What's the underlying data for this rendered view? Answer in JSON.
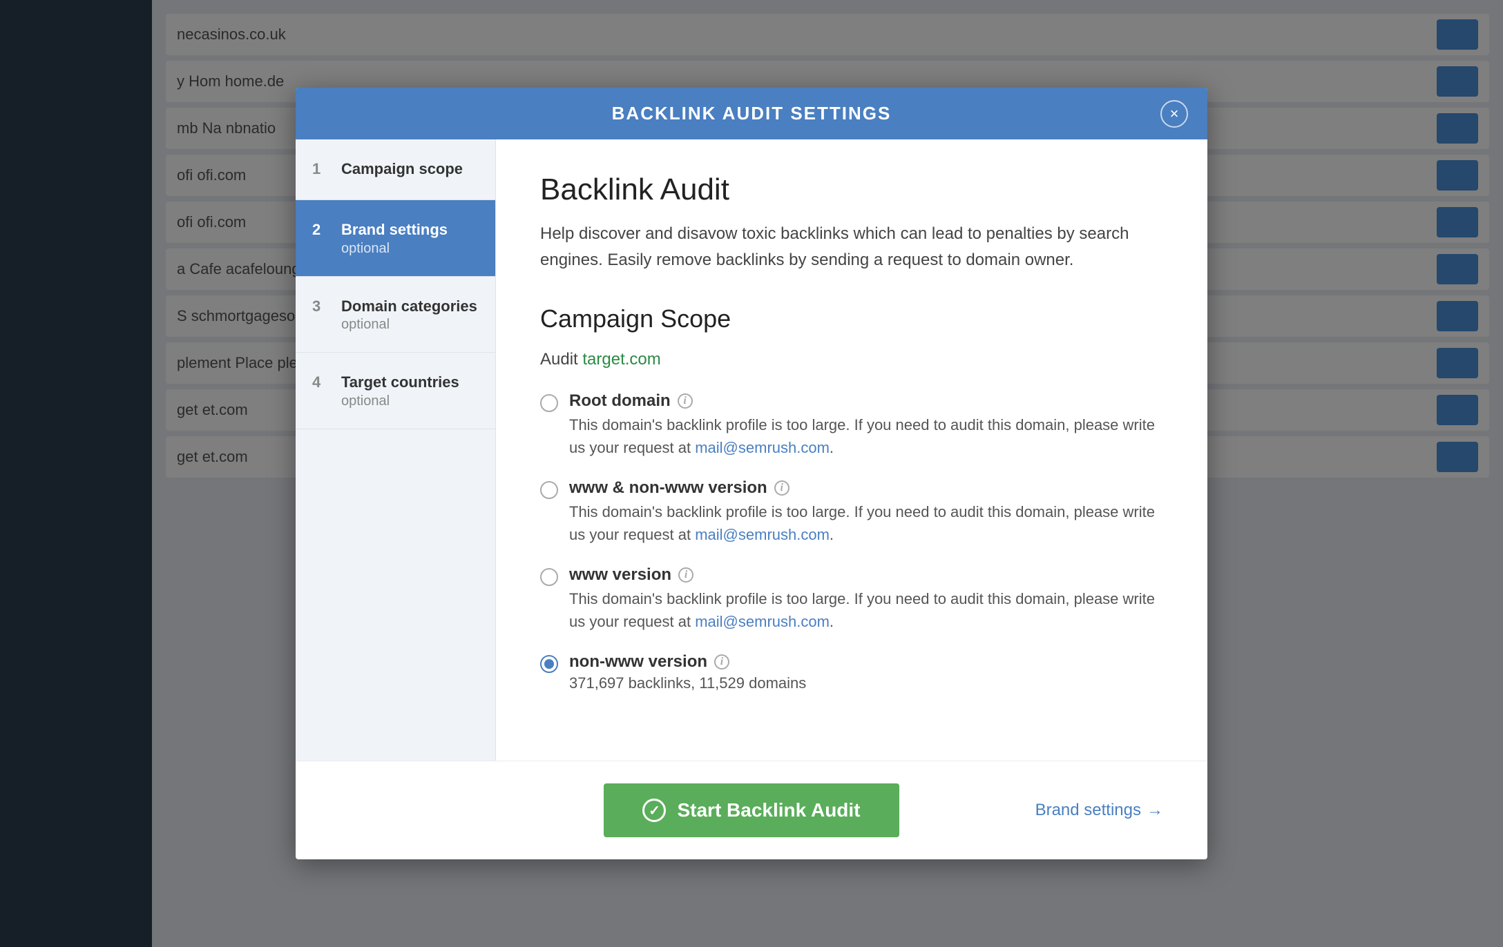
{
  "modal": {
    "header_title": "BACKLINK AUDIT SETTINGS",
    "title": "Backlink Audit",
    "description": "Help discover and disavow toxic backlinks which can lead to penalties by search engines. Easily remove backlinks by sending a request to domain owner.",
    "campaign_scope_title": "Campaign Scope",
    "audit_label": "Audit",
    "audit_domain": "target.com",
    "close_label": "×"
  },
  "nav": {
    "items": [
      {
        "num": "1",
        "label": "Campaign scope",
        "sublabel": "",
        "active": false
      },
      {
        "num": "2",
        "label": "Brand settings",
        "sublabel": "optional",
        "active": true
      },
      {
        "num": "3",
        "label": "Domain categories",
        "sublabel": "optional",
        "active": false
      },
      {
        "num": "4",
        "label": "Target countries",
        "sublabel": "optional",
        "active": false
      }
    ]
  },
  "radio_options": [
    {
      "id": "root-domain",
      "label": "Root domain",
      "checked": false,
      "has_info": true,
      "desc_plain": "This domain's backlink profile is too large. If you need to audit this domain, please write us your request at",
      "desc_email": "mail@semrush.com",
      "desc_suffix": "."
    },
    {
      "id": "www-non-www",
      "label": "www & non-www version",
      "checked": false,
      "has_info": true,
      "desc_plain": "This domain's backlink profile is too large. If you need to audit this domain, please write us your request at",
      "desc_email": "mail@semrush.com",
      "desc_suffix": "."
    },
    {
      "id": "www-version",
      "label": "www version",
      "checked": false,
      "has_info": true,
      "desc_plain": "This domain's backlink profile is too large. If you need to audit this domain, please write us your request at",
      "desc_email": "mail@semrush.com",
      "desc_suffix": "."
    },
    {
      "id": "non-www-version",
      "label": "non-www version",
      "checked": true,
      "has_info": true,
      "desc_count": "371,697 backlinks, 11,529 domains",
      "desc_plain": null,
      "desc_email": null
    }
  ],
  "footer": {
    "start_btn_label": "Start Backlink Audit",
    "brand_settings_label": "Brand settings",
    "brand_settings_arrow": "→"
  },
  "info_icon_label": "i",
  "bg_rows": [
    {
      "text": "necasinos.co.uk"
    },
    {
      "text": "y Hom home.de"
    },
    {
      "text": "mb Na nbnatio"
    },
    {
      "text": "ofi ofi.com"
    },
    {
      "text": "ofi ofi.com"
    },
    {
      "text": "a Cafe acafelounge.com"
    },
    {
      "text": "S schmortgagesolutions.co.uk"
    },
    {
      "text": "plement Place plementplace.co.uk"
    },
    {
      "text": "get et.com"
    },
    {
      "text": "get et.com"
    }
  ]
}
